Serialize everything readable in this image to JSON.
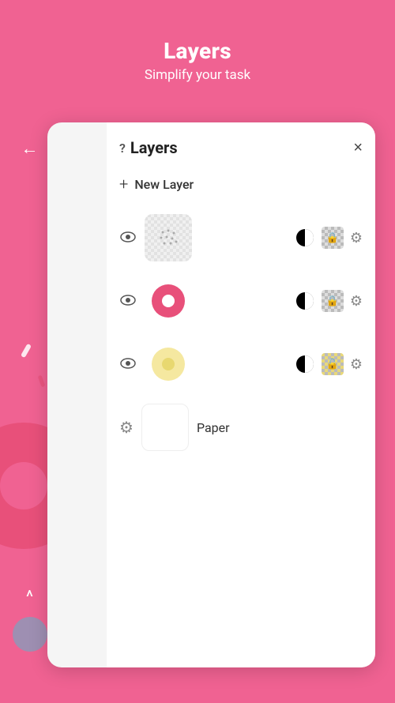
{
  "header": {
    "title": "Layers",
    "subtitle": "Simplify your task"
  },
  "panel": {
    "title": "Layers",
    "help_label": "?",
    "close_label": "×",
    "new_layer_label": "New Layer",
    "layers": [
      {
        "id": "layer-1",
        "type": "dots",
        "visible": true
      },
      {
        "id": "layer-2",
        "type": "donut-pink",
        "visible": true
      },
      {
        "id": "layer-3",
        "type": "donut-yellow",
        "visible": true
      }
    ],
    "paper_label": "Paper"
  },
  "sidebar": {
    "back_label": "←",
    "chevron_label": "^"
  }
}
